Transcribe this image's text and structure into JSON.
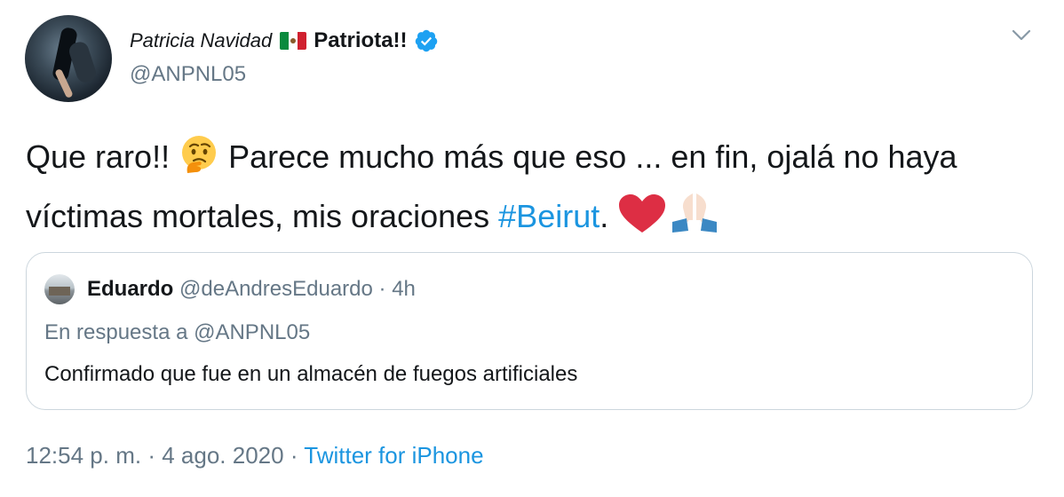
{
  "author": {
    "name_part1": "Patricia Navidad",
    "name_part2": "Patriota!!",
    "handle": "@ANPNL05",
    "flag_icon": "mexico-flag-icon",
    "verified_icon": "verified-badge-icon"
  },
  "tweet": {
    "text_before": "Que raro!! ",
    "text_mid": " Parece mucho más que eso ... en fin, ojalá no haya víctimas mortales, mis oraciones ",
    "hashtag": "#Beirut",
    "text_after": ". ",
    "emojis": [
      "thinking-face-icon",
      "red-heart-icon",
      "folded-hands-icon"
    ]
  },
  "quote": {
    "name": "Eduardo",
    "handle": "@deAndresEduardo",
    "separator": "·",
    "time": "4h",
    "reply_to": "En respuesta a @ANPNL05",
    "text": "Confirmado que fue en un almacén de fuegos artificiales"
  },
  "footer": {
    "time": "12:54 p. m.",
    "separator": "·",
    "date": "4 ago. 2020",
    "source": "Twitter for iPhone"
  },
  "colors": {
    "link": "#1b95e0",
    "muted": "#657786",
    "border": "#ccd6dd",
    "text": "#14171a"
  }
}
